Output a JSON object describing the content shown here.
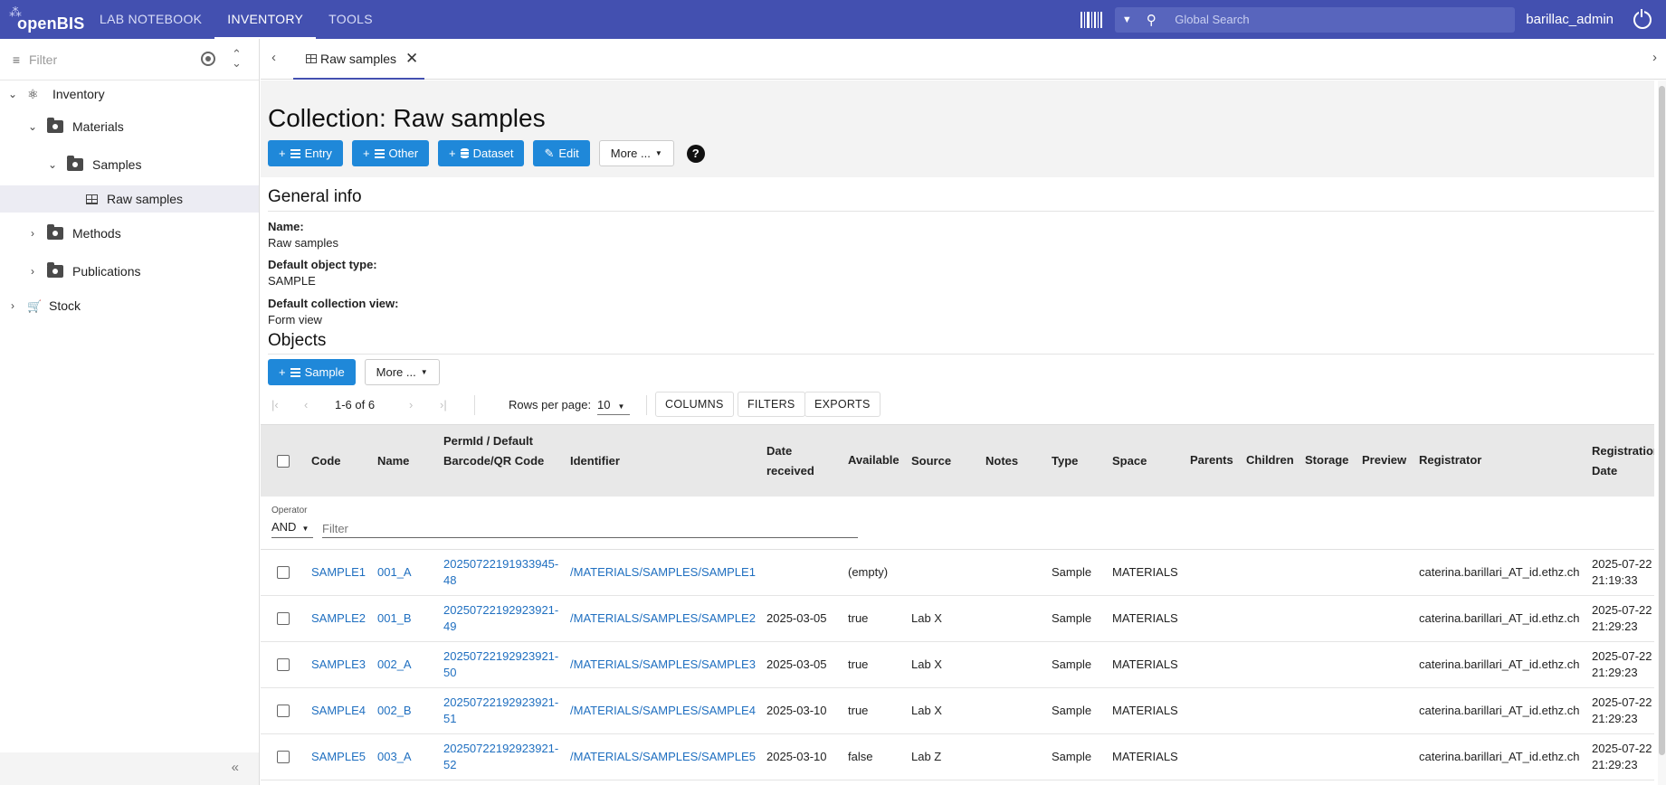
{
  "topbar": {
    "logo_text": "openBIS",
    "tabs": [
      "LAB NOTEBOOK",
      "INVENTORY",
      "TOOLS"
    ],
    "active_tab": "INVENTORY",
    "search_placeholder": "Global Search",
    "user": "barillac_admin",
    "colors": {
      "bar": "#4350b0",
      "accent": "#1f88d9"
    },
    "icons": [
      "barcode-icon",
      "chevron-down-icon",
      "search-icon",
      "power-icon"
    ]
  },
  "sidebar": {
    "filter_placeholder": "Filter",
    "tree": [
      {
        "label": "Inventory",
        "icon": "inventory-icon",
        "expanded": true
      },
      {
        "label": "Materials",
        "icon": "folder-icon",
        "expanded": true
      },
      {
        "label": "Samples",
        "icon": "folder-icon",
        "expanded": true
      },
      {
        "label": "Raw samples",
        "icon": "grid-icon",
        "selected": true
      },
      {
        "label": "Methods",
        "icon": "folder-icon",
        "expanded": false
      },
      {
        "label": "Publications",
        "icon": "folder-icon",
        "expanded": false
      },
      {
        "label": "Stock",
        "icon": "cart-icon",
        "expanded": false
      }
    ]
  },
  "tabs": {
    "open_tab": "Raw samples"
  },
  "page": {
    "title": "Collection: Raw samples",
    "buttons": {
      "entry": "Entry",
      "other": "Other",
      "dataset": "Dataset",
      "edit": "Edit",
      "more": "More ..."
    },
    "help": "?",
    "general_info": {
      "heading": "General info",
      "fields": [
        {
          "label": "Name:",
          "value": "Raw samples"
        },
        {
          "label": "Default object type:",
          "value": "SAMPLE"
        },
        {
          "label": "Default collection view:",
          "value": "Form view"
        }
      ]
    },
    "objects": {
      "heading": "Objects",
      "sample_button": "Sample",
      "more_button": "More ...",
      "pagination": {
        "range": "1-6 of 6",
        "rows_per_page_label": "Rows per page:",
        "rows_per_page": "10"
      },
      "toolbar": {
        "columns": "COLUMNS",
        "filters": "FILTERS",
        "exports": "EXPORTS"
      },
      "filter": {
        "operator_label": "Operator",
        "operator": "AND",
        "placeholder": "Filter"
      },
      "columns": [
        "Code",
        "Name",
        "PermId / Default Barcode/QR Code",
        "Identifier",
        "Date received",
        "Available",
        "Source",
        "Notes",
        "Type",
        "Space",
        "Parents",
        "Children",
        "Storage",
        "Preview",
        "Registrator",
        "Registration Date"
      ],
      "rows": [
        {
          "code": "SAMPLE1",
          "name": "001_A",
          "permid": "20250722191933945-48",
          "identifier": "/MATERIALS/SAMPLES/SAMPLE1",
          "date_received": "",
          "available": "(empty)",
          "source": "",
          "type": "Sample",
          "space": "MATERIALS",
          "registrator": "caterina.barillari_AT_id.ethz.ch",
          "reg_date": "2025-07-22 21:19:33"
        },
        {
          "code": "SAMPLE2",
          "name": "001_B",
          "permid": "20250722192923921-49",
          "identifier": "/MATERIALS/SAMPLES/SAMPLE2",
          "date_received": "2025-03-05",
          "available": "true",
          "source": "Lab X",
          "type": "Sample",
          "space": "MATERIALS",
          "registrator": "caterina.barillari_AT_id.ethz.ch",
          "reg_date": "2025-07-22 21:29:23"
        },
        {
          "code": "SAMPLE3",
          "name": "002_A",
          "permid": "20250722192923921-50",
          "identifier": "/MATERIALS/SAMPLES/SAMPLE3",
          "date_received": "2025-03-05",
          "available": "true",
          "source": "Lab X",
          "type": "Sample",
          "space": "MATERIALS",
          "registrator": "caterina.barillari_AT_id.ethz.ch",
          "reg_date": "2025-07-22 21:29:23"
        },
        {
          "code": "SAMPLE4",
          "name": "002_B",
          "permid": "20250722192923921-51",
          "identifier": "/MATERIALS/SAMPLES/SAMPLE4",
          "date_received": "2025-03-10",
          "available": "true",
          "source": "Lab X",
          "type": "Sample",
          "space": "MATERIALS",
          "registrator": "caterina.barillari_AT_id.ethz.ch",
          "reg_date": "2025-07-22 21:29:23"
        },
        {
          "code": "SAMPLE5",
          "name": "003_A",
          "permid": "20250722192923921-52",
          "identifier": "/MATERIALS/SAMPLES/SAMPLE5",
          "date_received": "2025-03-10",
          "available": "false",
          "source": "Lab Z",
          "type": "Sample",
          "space": "MATERIALS",
          "registrator": "caterina.barillari_AT_id.ethz.ch",
          "reg_date": "2025-07-22 21:29:23"
        }
      ]
    }
  }
}
